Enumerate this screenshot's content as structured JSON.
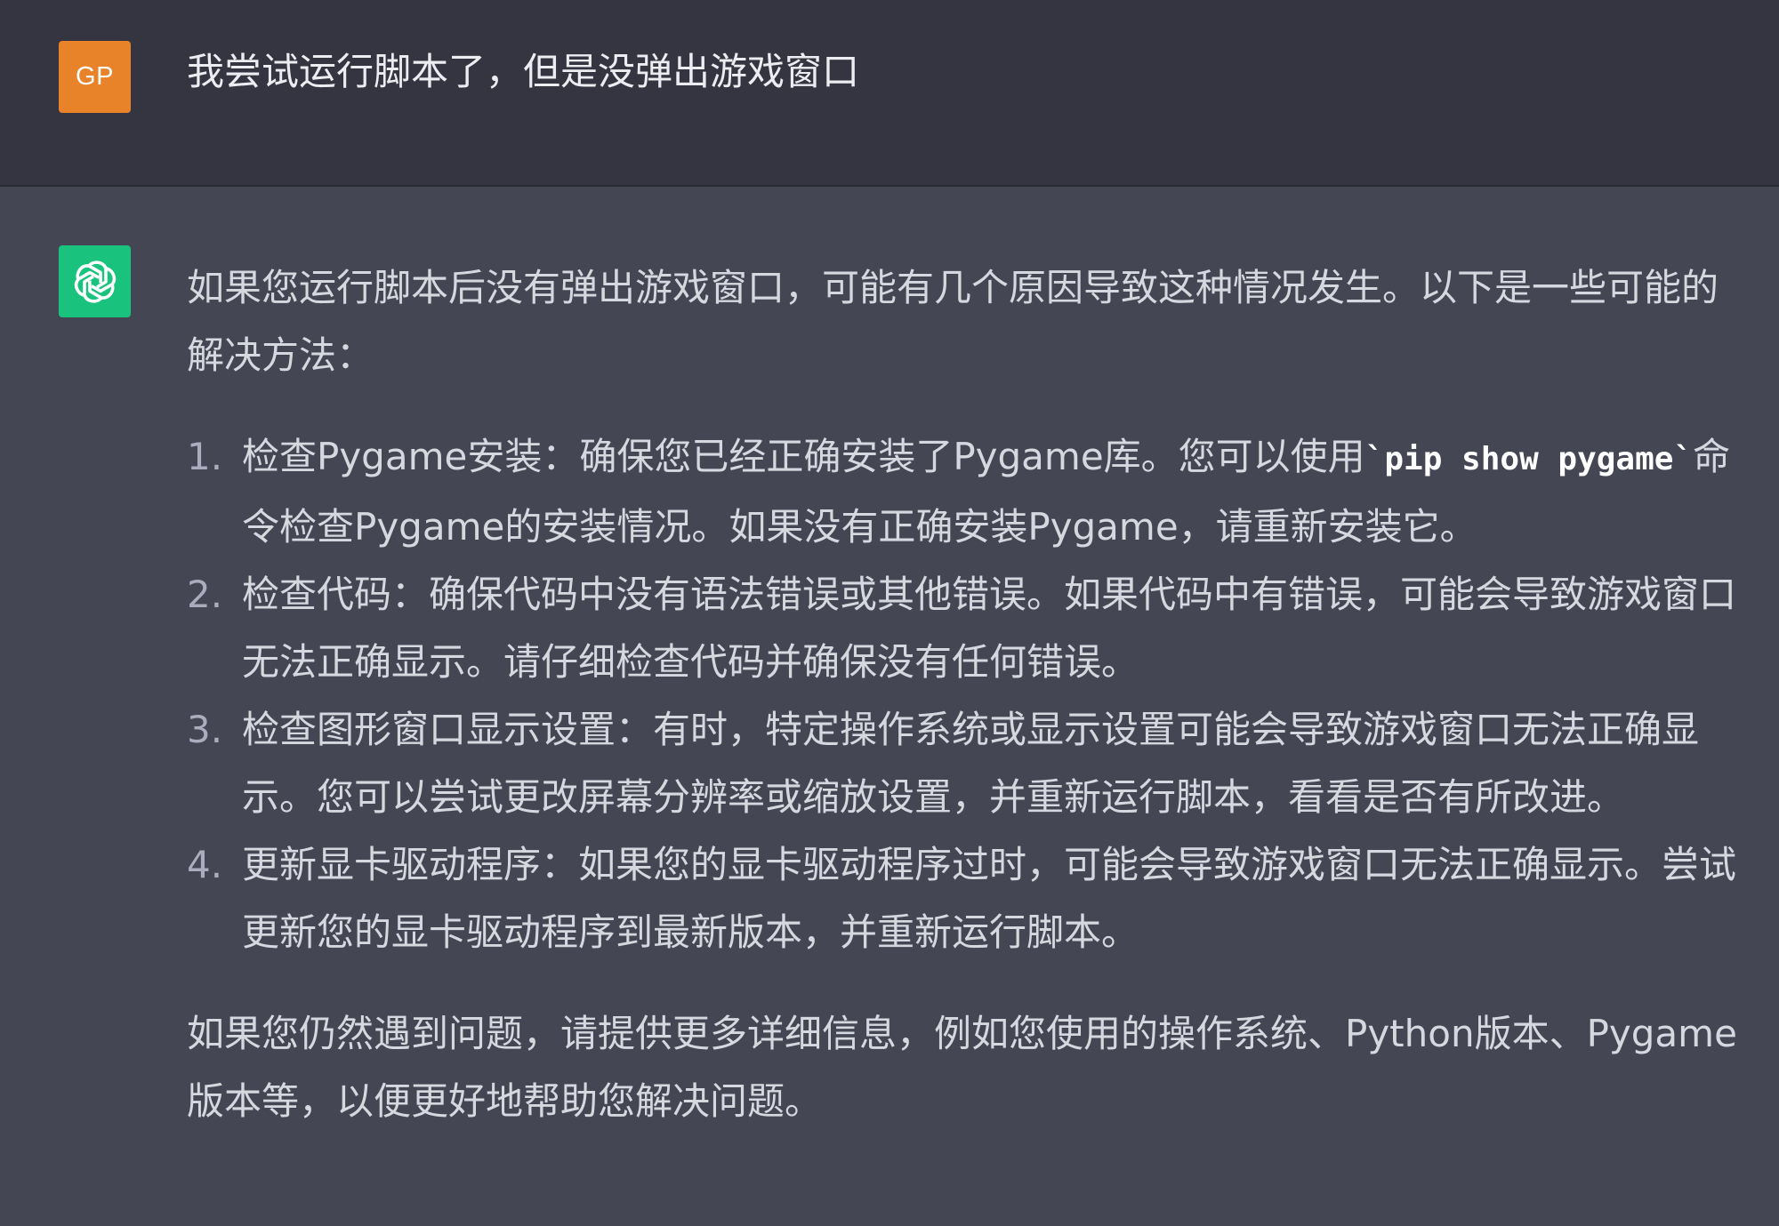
{
  "user_message": {
    "avatar_initials": "GP",
    "avatar_color": "#e8832a",
    "text": "我尝试运行脚本了，但是没弹出游戏窗口"
  },
  "assistant_message": {
    "avatar_icon": "openai-logo-icon",
    "avatar_color": "#19c37d",
    "intro": "如果您运行脚本后没有弹出游戏窗口，可能有几个原因导致这种情况发生。以下是一些可能的解决方法：",
    "steps": [
      {
        "number": "1.",
        "before_code": "检查Pygame安装：确保您已经正确安装了Pygame库。您可以使用",
        "code": "`pip show pygame`",
        "after_code": "命令检查Pygame的安装情况。如果没有正确安装Pygame，请重新安装它。"
      },
      {
        "number": "2.",
        "text": "检查代码：确保代码中没有语法错误或其他错误。如果代码中有错误，可能会导致游戏窗口无法正确显示。请仔细检查代码并确保没有任何错误。"
      },
      {
        "number": "3.",
        "text": "检查图形窗口显示设置：有时，特定操作系统或显示设置可能会导致游戏窗口无法正确显示。您可以尝试更改屏幕分辨率或缩放设置，并重新运行脚本，看看是否有所改进。"
      },
      {
        "number": "4.",
        "text": "更新显卡驱动程序：如果您的显卡驱动程序过时，可能会导致游戏窗口无法正确显示。尝试更新您的显卡驱动程序到最新版本，并重新运行脚本。"
      }
    ],
    "outro": "如果您仍然遇到问题，请提供更多详细信息，例如您使用的操作系统、Python版本、Pygame版本等，以便更好地帮助您解决问题。"
  },
  "colors": {
    "user_row_bg": "#343541",
    "assistant_row_bg": "#444654",
    "text": "#ececf1"
  }
}
